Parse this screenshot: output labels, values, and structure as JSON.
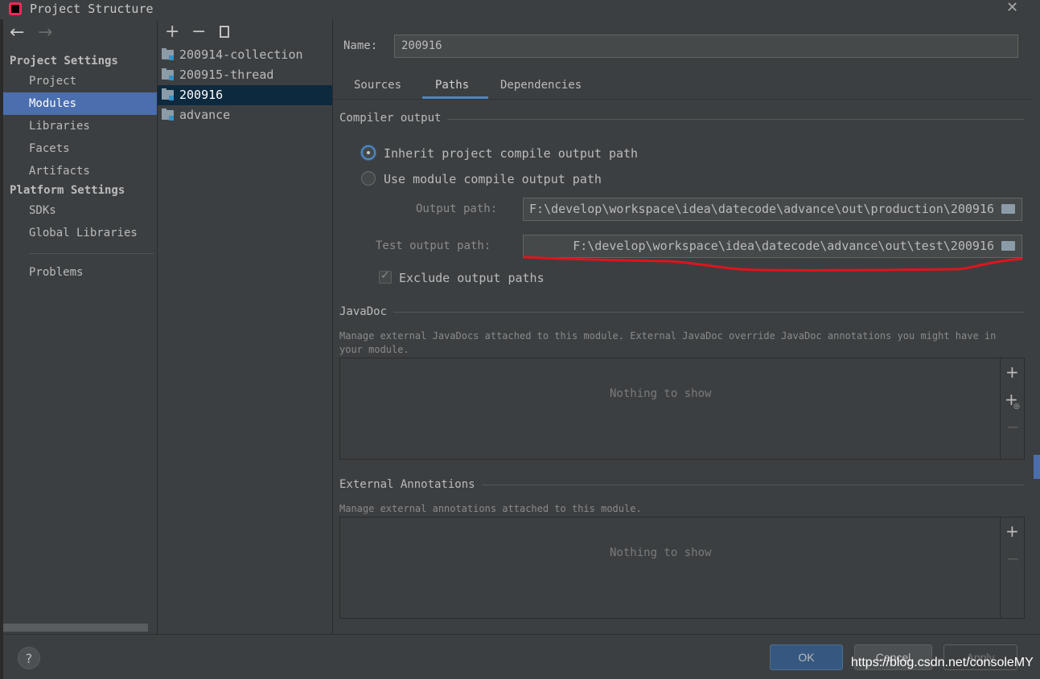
{
  "window": {
    "title": "Project Structure"
  },
  "nav": {
    "back_icon": "arrow-left-icon",
    "forward_icon": "arrow-right-icon",
    "project_settings_heading": "Project Settings",
    "project_items": [
      "Project",
      "Modules",
      "Libraries",
      "Facets",
      "Artifacts"
    ],
    "platform_settings_heading": "Platform Settings",
    "platform_items": [
      "SDKs",
      "Global Libraries"
    ],
    "problems": "Problems",
    "selected": "Modules"
  },
  "modules": {
    "toolbar": {
      "add": "+",
      "remove": "−",
      "copy_icon": "copy-icon"
    },
    "items": [
      "200914-collection",
      "200915-thread",
      "200916",
      "advance"
    ],
    "selected": "200916"
  },
  "detail": {
    "name_label": "Name:",
    "name_value": "200916",
    "tabs": [
      "Sources",
      "Paths",
      "Dependencies"
    ],
    "active_tab": "Paths",
    "compiler_output": {
      "title": "Compiler output",
      "inherit_label": "Inherit project compile output path",
      "use_module_label": "Use module compile output path",
      "selected": "inherit",
      "output_path_label": "Output path:",
      "output_path_value": "F:\\develop\\workspace\\idea\\datecode\\advance\\out\\production\\200916",
      "test_output_path_label": "Test output path:",
      "test_output_path_value": "F:\\develop\\workspace\\idea\\datecode\\advance\\out\\test\\200916",
      "exclude_label": "Exclude output paths",
      "exclude_checked": true
    },
    "javadoc": {
      "title": "JavaDoc",
      "description": "Manage external JavaDocs attached to this module. External JavaDoc override JavaDoc annotations you might have in your module.",
      "empty_text": "Nothing to show",
      "buttons": [
        "+",
        "+",
        "−"
      ]
    },
    "external_annotations": {
      "title": "External Annotations",
      "description": "Manage external annotations attached to this module.",
      "empty_text": "Nothing to show",
      "buttons": [
        "+",
        "−"
      ]
    }
  },
  "footer": {
    "help": "?",
    "ok": "OK",
    "cancel": "Cancel",
    "apply": "Apply"
  },
  "watermark": "https://blog.csdn.net/consoleMY",
  "colors": {
    "selection": "#4b6eaf",
    "accent": "#4a88c7",
    "annotation_red": "#e0141c"
  }
}
